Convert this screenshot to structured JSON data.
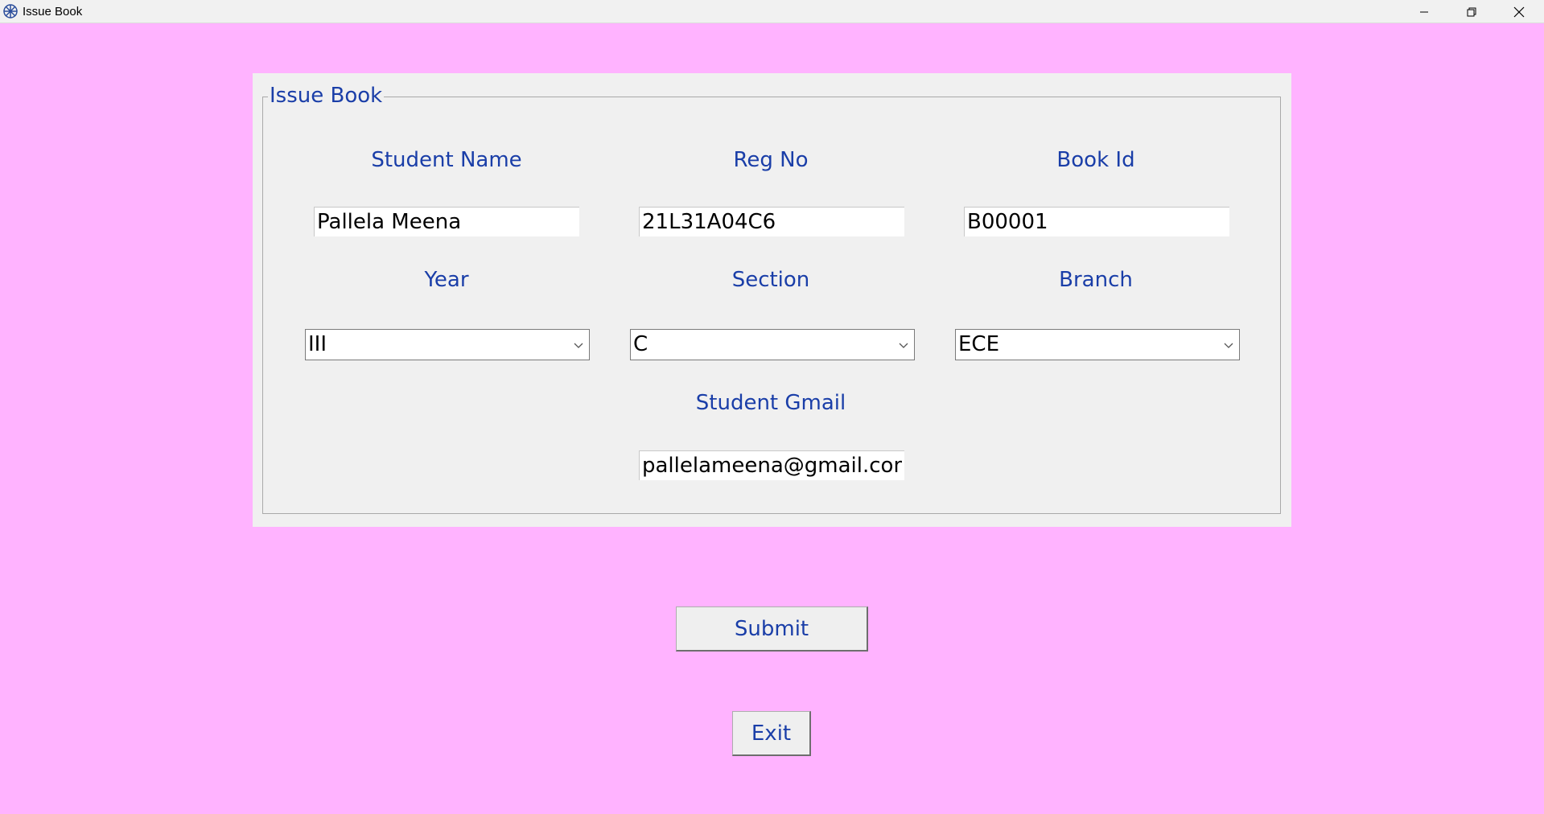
{
  "window": {
    "title": "Issue Book",
    "app_icon": "snowflake-tk-icon",
    "controls": [
      "minimize-icon",
      "restore-icon",
      "close-icon"
    ]
  },
  "form": {
    "group_title": "Issue Book",
    "student_name": {
      "label": "Student Name",
      "value": "Pallela Meena"
    },
    "reg_no": {
      "label": "Reg No",
      "value": "21L31A04C6"
    },
    "book_id": {
      "label": "Book Id",
      "value": "B00001"
    },
    "year": {
      "label": "Year",
      "selected": "III"
    },
    "section": {
      "label": "Section",
      "selected": "C"
    },
    "branch": {
      "label": "Branch",
      "selected": "ECE"
    },
    "student_gmail": {
      "label": "Student Gmail",
      "value": "pallelameena@gmail.com"
    }
  },
  "buttons": {
    "submit_label": "Submit",
    "exit_label": "Exit"
  },
  "colors": {
    "background": "#ffb3ff",
    "panel": "#f0f0f0",
    "label_text": "#1a3ea8"
  }
}
